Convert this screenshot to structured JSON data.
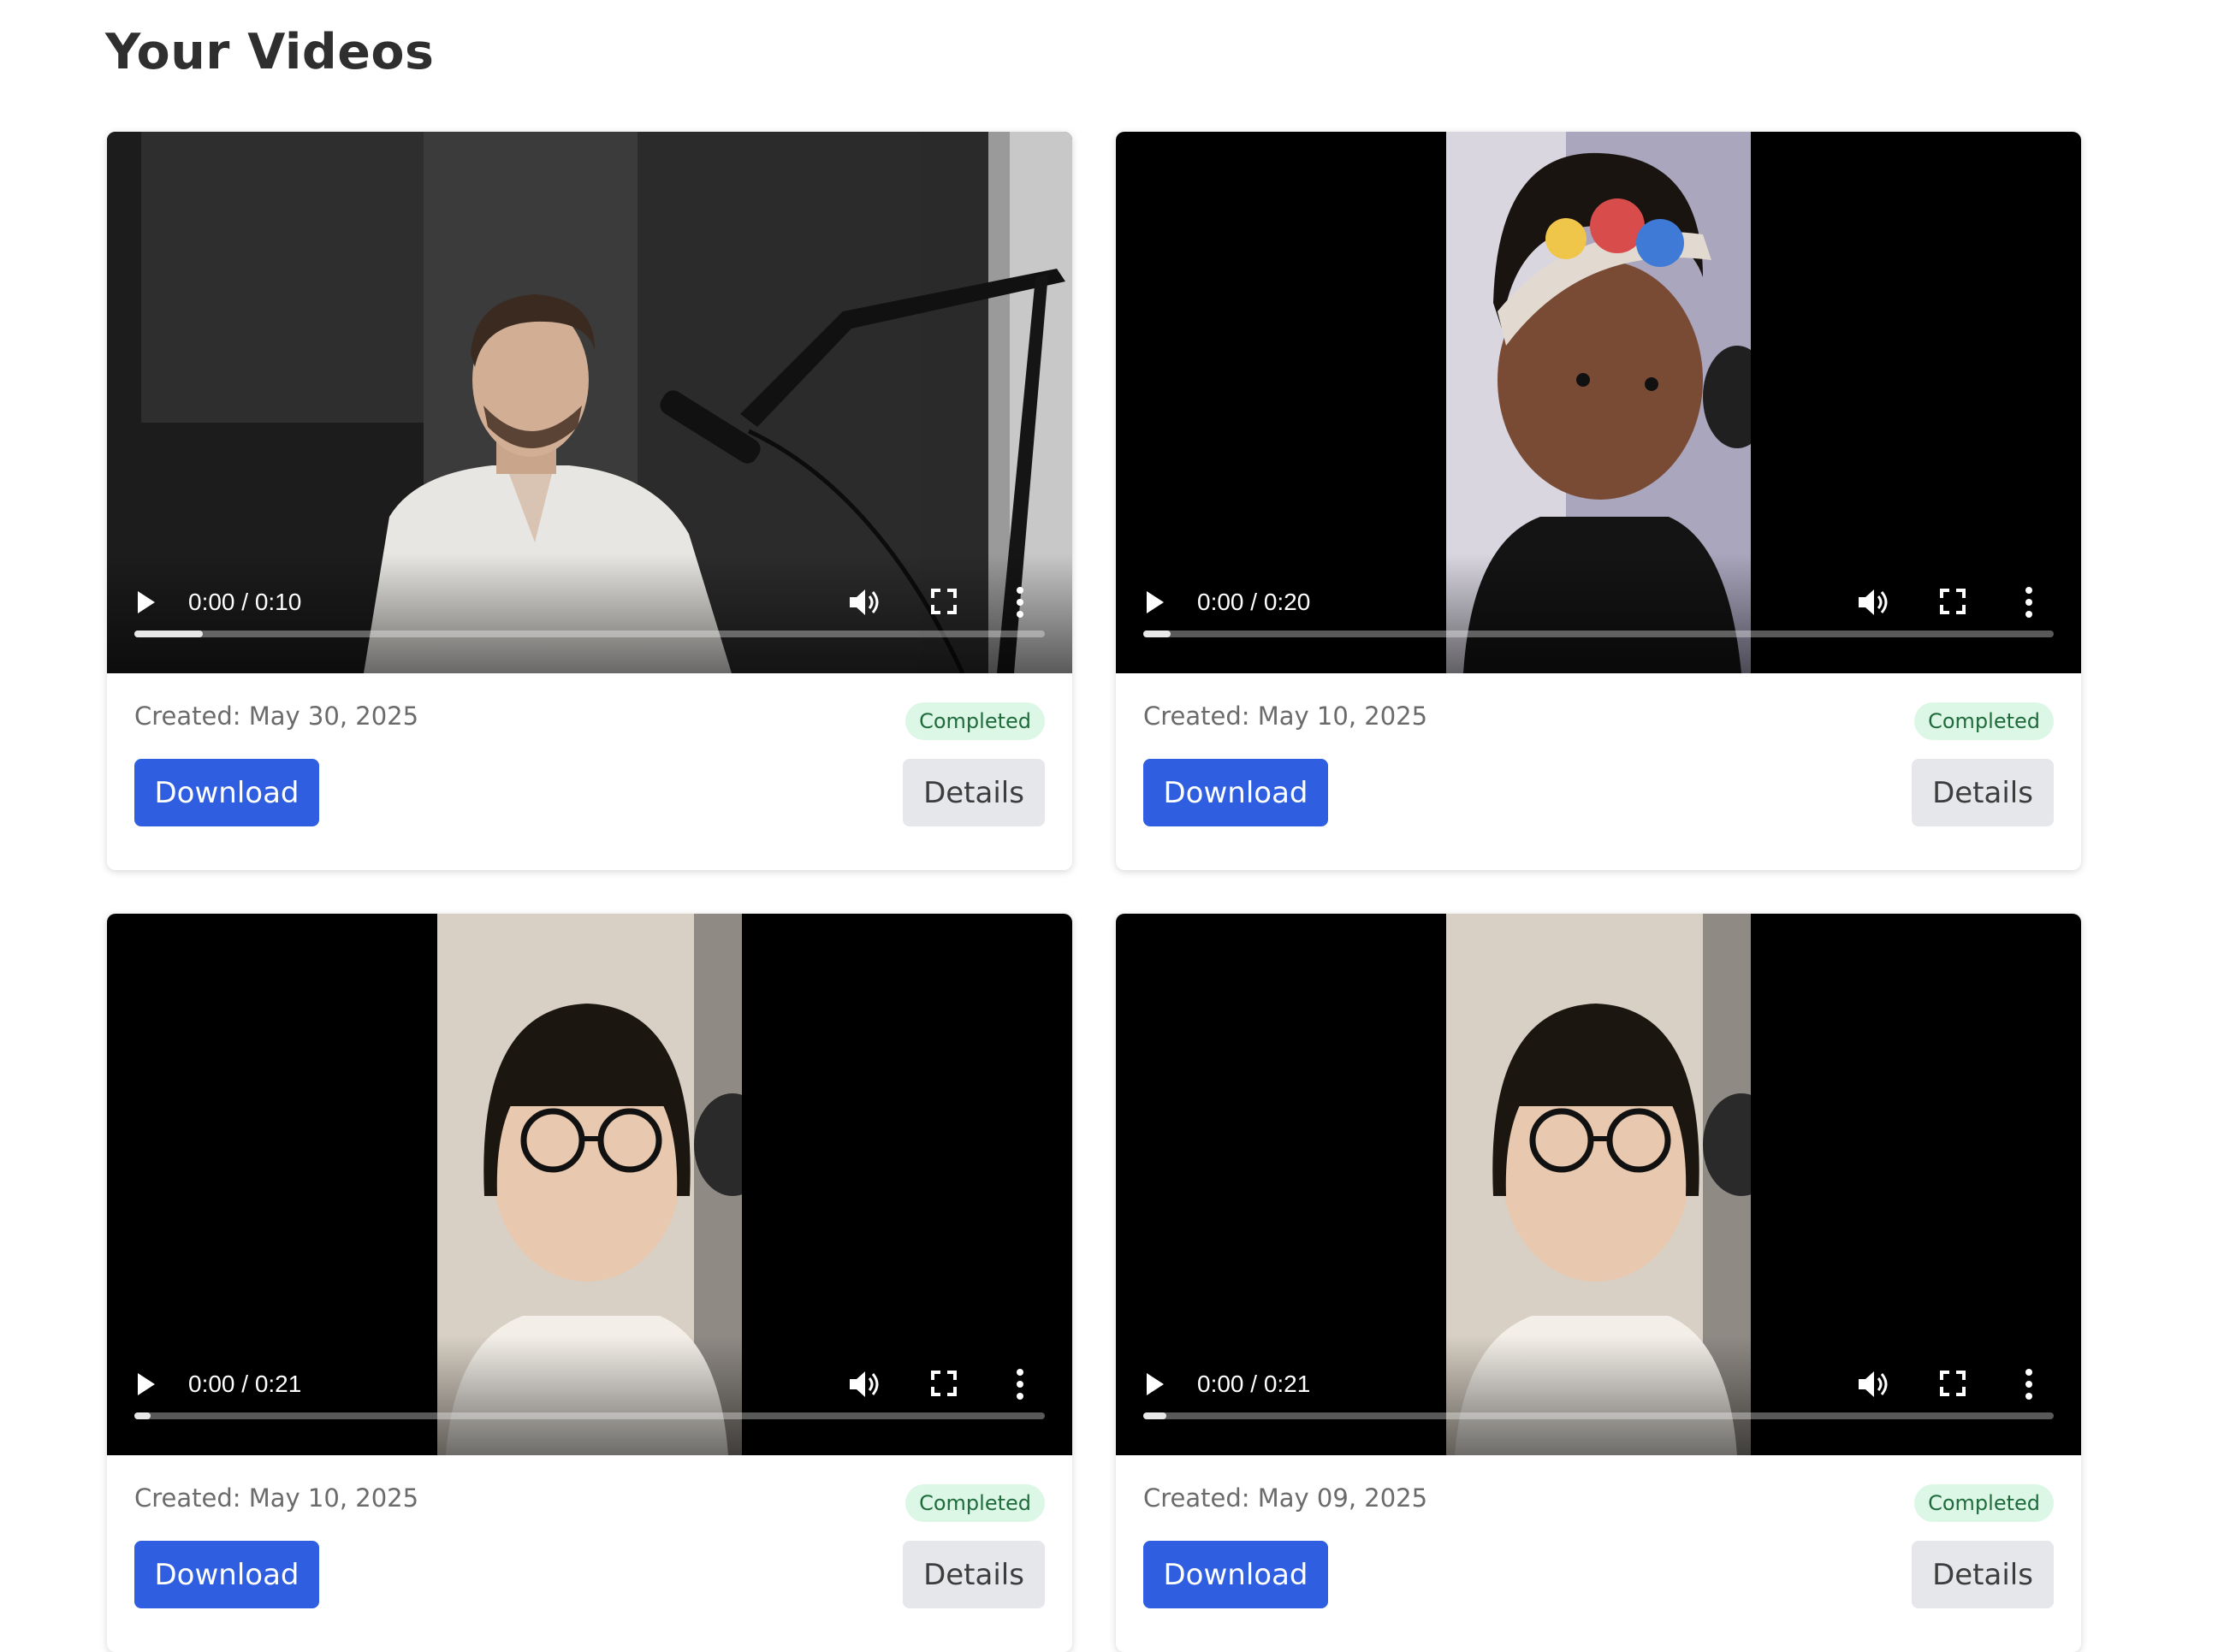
{
  "page": {
    "title": "Your Videos"
  },
  "videos": [
    {
      "time": "0:00 / 0:10",
      "created": "Created: May 30, 2025",
      "status": "Completed",
      "download_label": "Download",
      "details_label": "Details",
      "progress": 0.075
    },
    {
      "time": "0:00 / 0:20",
      "created": "Created: May 10, 2025",
      "status": "Completed",
      "download_label": "Download",
      "details_label": "Details",
      "progress": 0.03
    },
    {
      "time": "0:00 / 0:21",
      "created": "Created: May 10, 2025",
      "status": "Completed",
      "download_label": "Download",
      "details_label": "Details",
      "progress": 0.018
    },
    {
      "time": "0:00 / 0:21",
      "created": "Created: May 09, 2025",
      "status": "Completed",
      "download_label": "Download",
      "details_label": "Details",
      "progress": 0.025
    }
  ],
  "icons": {
    "play": "play-icon",
    "volume": "volume-icon",
    "fullscreen": "fullscreen-icon",
    "more": "more-vertical-icon"
  },
  "colors": {
    "primary": "#2f5fe0",
    "badge_bg": "#dcf7e6",
    "badge_text": "#1f6b3c"
  }
}
